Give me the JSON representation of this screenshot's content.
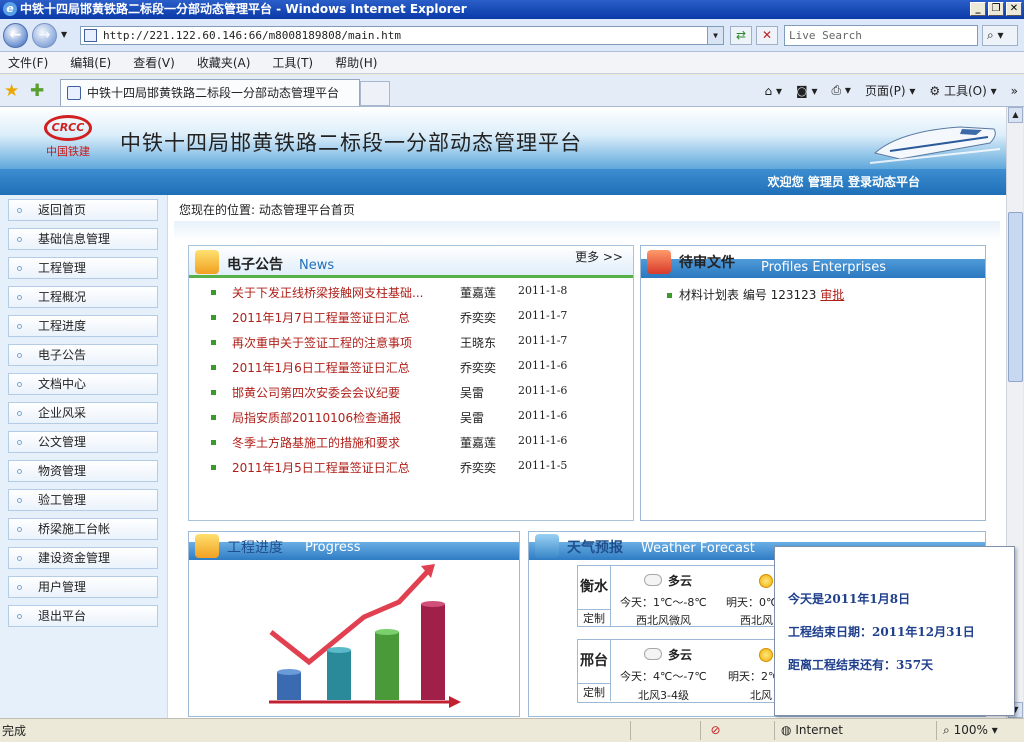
{
  "window": {
    "title": "中铁十四局邯黄铁路二标段一分部动态管理平台 - Windows Internet Explorer"
  },
  "addressbar": {
    "url": "http://221.122.60.146:66/m8008189808/main.htm",
    "search_placeholder": "Live Search"
  },
  "menu": {
    "items": [
      "文件(F)",
      "编辑(E)",
      "查看(V)",
      "收藏夹(A)",
      "工具(T)",
      "帮助(H)"
    ]
  },
  "tabs": {
    "active_label": "中铁十四局邯黄铁路二标段一分部动态管理平台"
  },
  "commandbar": {
    "page_label": "页面(P)",
    "tools_label": "工具(O)"
  },
  "banner": {
    "logo_text": "CRCC",
    "logo_caption": "中国铁建",
    "title": "中铁十四局邯黄铁路二标段一分部动态管理平台",
    "welcome": "欢迎您  管理员  登录动态平台"
  },
  "sidebar": {
    "items": [
      {
        "label": "返回首页"
      },
      {
        "label": "基础信息管理"
      },
      {
        "label": "工程管理"
      },
      {
        "label": "工程概况"
      },
      {
        "label": "工程进度"
      },
      {
        "label": "电子公告"
      },
      {
        "label": "文档中心"
      },
      {
        "label": "企业风采"
      },
      {
        "label": "公文管理"
      },
      {
        "label": "物资管理"
      },
      {
        "label": "验工管理"
      },
      {
        "label": "桥梁施工台帐"
      },
      {
        "label": "建设资金管理"
      },
      {
        "label": "用户管理"
      },
      {
        "label": "退出平台"
      }
    ]
  },
  "breadcrumb": "您现在的位置: 动态管理平台首页",
  "news": {
    "title_zh": "电子公告",
    "title_en": "News",
    "more": "更多 >>",
    "items": [
      {
        "title": "关于下发正线桥梁接触网支柱基础...",
        "author": "董嘉莲",
        "date": "2011-1-8"
      },
      {
        "title": "2011年1月7日工程量签证日汇总",
        "author": "乔奕奕",
        "date": "2011-1-7"
      },
      {
        "title": "再次重申关于签证工程的注意事项",
        "author": "王晓东",
        "date": "2011-1-7"
      },
      {
        "title": "2011年1月6日工程量签证日汇总",
        "author": "乔奕奕",
        "date": "2011-1-6"
      },
      {
        "title": "邯黄公司第四次安委会会议纪要",
        "author": "吴雷",
        "date": "2011-1-6"
      },
      {
        "title": "局指安质部20110106检查通报",
        "author": "吴雷",
        "date": "2011-1-6"
      },
      {
        "title": "冬季土方路基施工的措施和要求",
        "author": "董嘉莲",
        "date": "2011-1-6"
      },
      {
        "title": "2011年1月5日工程量签证日汇总",
        "author": "乔奕奕",
        "date": "2011-1-5"
      }
    ]
  },
  "pending": {
    "title_zh": "待审文件",
    "title_en": "Profiles Enterprises",
    "item_text": "材料计划表  编号 123123",
    "item_link": "审批"
  },
  "progress": {
    "title_zh": "工程进度",
    "title_en": "Progress"
  },
  "weather": {
    "title_zh": "天气预报",
    "title_en": "Weather Forecast",
    "cities": [
      {
        "name": "衡水",
        "custom": "定制",
        "condition": "多云",
        "today": "今天：1℃～-8℃",
        "tomorrow": "明天：0℃",
        "wind1": "西北风微风",
        "wind2": "西北风"
      },
      {
        "name": "邢台",
        "custom": "定制",
        "condition": "多云",
        "today": "今天：4℃～-7℃",
        "tomorrow": "明天：2℃",
        "wind1": "北风3-4级",
        "wind2": "北风"
      }
    ]
  },
  "popup": {
    "today": "今天是2011年1月8日",
    "end_date": "工程结束日期：2011年12月31日",
    "remaining": "距离工程结束还有：357天"
  },
  "status": {
    "text": "完成",
    "zone": "Internet",
    "zoom": "100%"
  },
  "colors": {
    "banner_blue": "#1f6fb8",
    "news_link": "#b0201a",
    "bullet_green": "#3a9a2a",
    "popup_text": "#1f3f8c"
  }
}
